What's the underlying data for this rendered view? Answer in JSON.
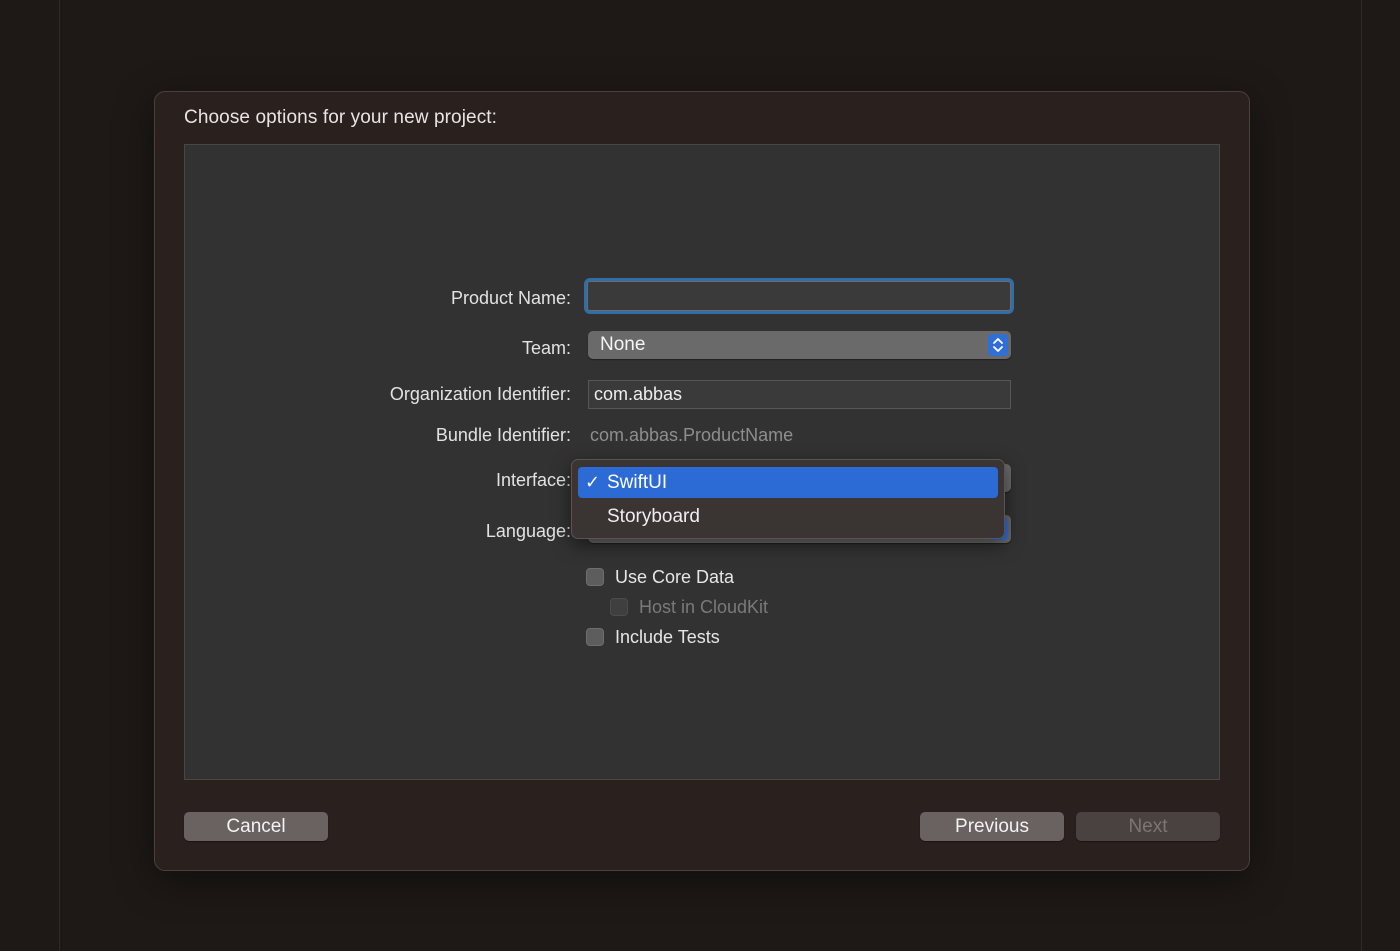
{
  "dialog": {
    "title": "Choose options for your new project:"
  },
  "form": {
    "product_name": {
      "label": "Product Name:",
      "value": ""
    },
    "team": {
      "label": "Team:",
      "selected": "None"
    },
    "organization_identifier": {
      "label": "Organization Identifier:",
      "value": "com.abbas"
    },
    "bundle_identifier": {
      "label": "Bundle Identifier:",
      "value": "com.abbas.ProductName"
    },
    "interface": {
      "label": "Interface:",
      "options": [
        {
          "label": "SwiftUI",
          "selected": true
        },
        {
          "label": "Storyboard",
          "selected": false
        }
      ]
    },
    "language": {
      "label": "Language:"
    },
    "checkboxes": {
      "use_core_data": {
        "label": "Use Core Data",
        "checked": false,
        "enabled": true
      },
      "host_in_cloudkit": {
        "label": "Host in CloudKit",
        "checked": false,
        "enabled": false
      },
      "include_tests": {
        "label": "Include Tests",
        "checked": false,
        "enabled": true
      }
    }
  },
  "icons": {
    "selection_check": "✓"
  },
  "buttons": {
    "cancel": "Cancel",
    "previous": "Previous",
    "next": "Next"
  },
  "colors": {
    "accent": "#2c6bd6",
    "focus_ring": "#2f6ea6"
  }
}
